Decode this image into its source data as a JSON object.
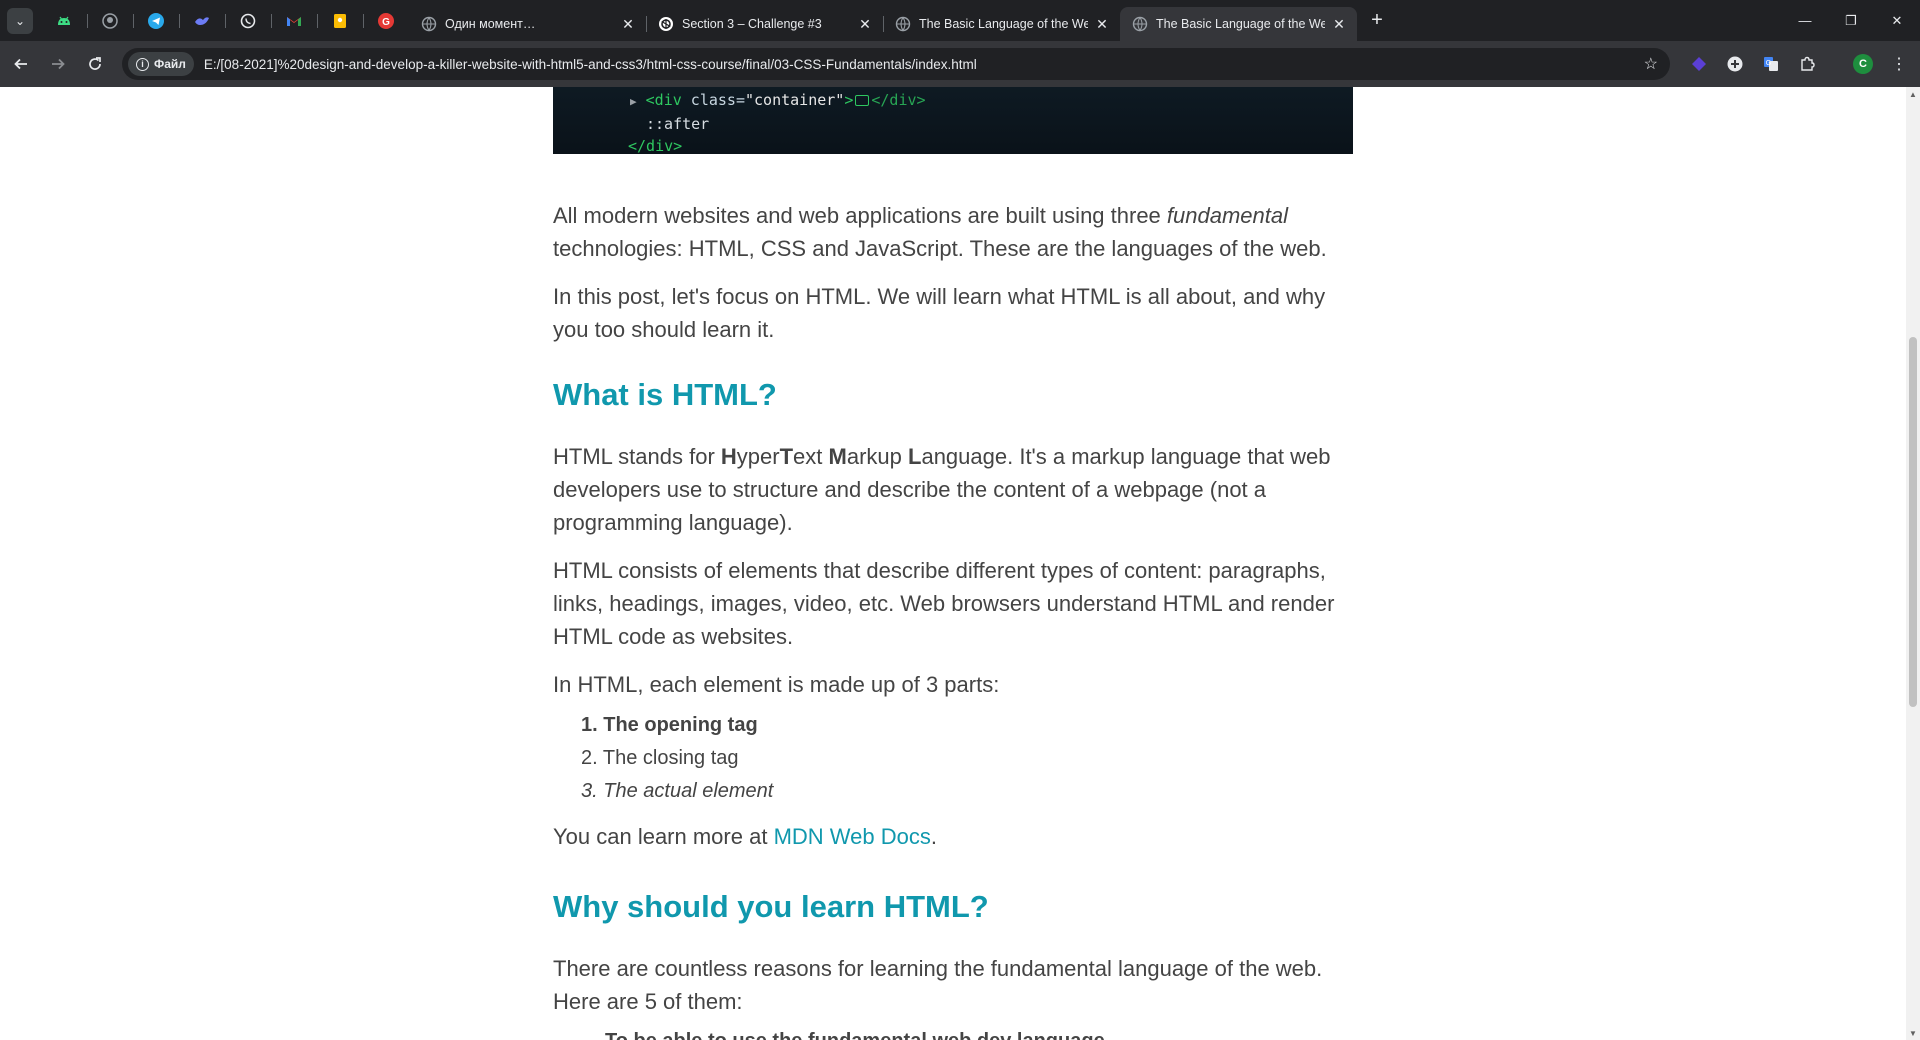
{
  "browser": {
    "tabs": [
      {
        "title": "Один момент…",
        "active": false
      },
      {
        "title": "Section 3 – Challenge #3",
        "active": false
      },
      {
        "title": "The Basic Language of the Web",
        "active": false
      },
      {
        "title": "The Basic Language of the Web",
        "active": true
      }
    ],
    "pinned_icons": [
      "android-icon",
      "github-icon",
      "telegram-icon",
      "bird-icon",
      "whatsapp-icon",
      "gmail-icon",
      "keep-icon",
      "grammarly-icon"
    ],
    "omnibox": {
      "chip_label": "Файл",
      "url": "E:/[08-2021]%20design-and-develop-a-killer-website-with-html5-and-css3/html-css-course/final/03-CSS-Fundamentals/index.html"
    },
    "profile_initial": "C",
    "colors": {
      "tab_strip": "#202124",
      "toolbar": "#35363a",
      "accent": "#1098ad"
    }
  },
  "page": {
    "code_image": {
      "line1_tag_open": "<div",
      "line1_attr": " class=",
      "line1_value": "\"container\"",
      "line1_tag_close": ">",
      "line1_tail": "</div>",
      "line2": "::after",
      "line3": "</div>"
    },
    "intro_p1_a": "All modern websites and web applications are built using three ",
    "intro_p1_em": "fundamental",
    "intro_p1_b": " technologies: HTML, CSS and JavaScript. These are the languages of the web.",
    "intro_p2": "In this post, let's focus on HTML. We will learn what HTML is all about, and why you too should learn it.",
    "h2_what": "What is HTML?",
    "what_p1": {
      "pre": "HTML stands for ",
      "h": "H",
      "yper": "yper",
      "t": "T",
      "ext": "ext ",
      "m": "M",
      "arkup": "arkup ",
      "l": "L",
      "anguage": "anguage",
      "post": ". It's a markup language that web developers use to structure and describe the content of a webpage (not a programming language)."
    },
    "what_p2": "HTML consists of elements that describe different types of content: paragraphs, links, headings, images, video, etc. Web browsers understand HTML and render HTML code as websites.",
    "what_p3": "In HTML, each element is made up of 3 parts:",
    "parts": [
      {
        "num": "1.",
        "text": "The opening tag"
      },
      {
        "num": "2.",
        "text": "The closing tag"
      },
      {
        "num": "3.",
        "text": "The actual element"
      }
    ],
    "learn_more_pre": "You can learn more at ",
    "learn_more_link": "MDN Web Docs",
    "learn_more_post": ".",
    "h2_why": "Why should you learn HTML?",
    "why_p1": "There are countless reasons for learning the fundamental language of the web. Here are 5 of them:",
    "why_first_item": "To be able to use the fundamental web dev language"
  }
}
